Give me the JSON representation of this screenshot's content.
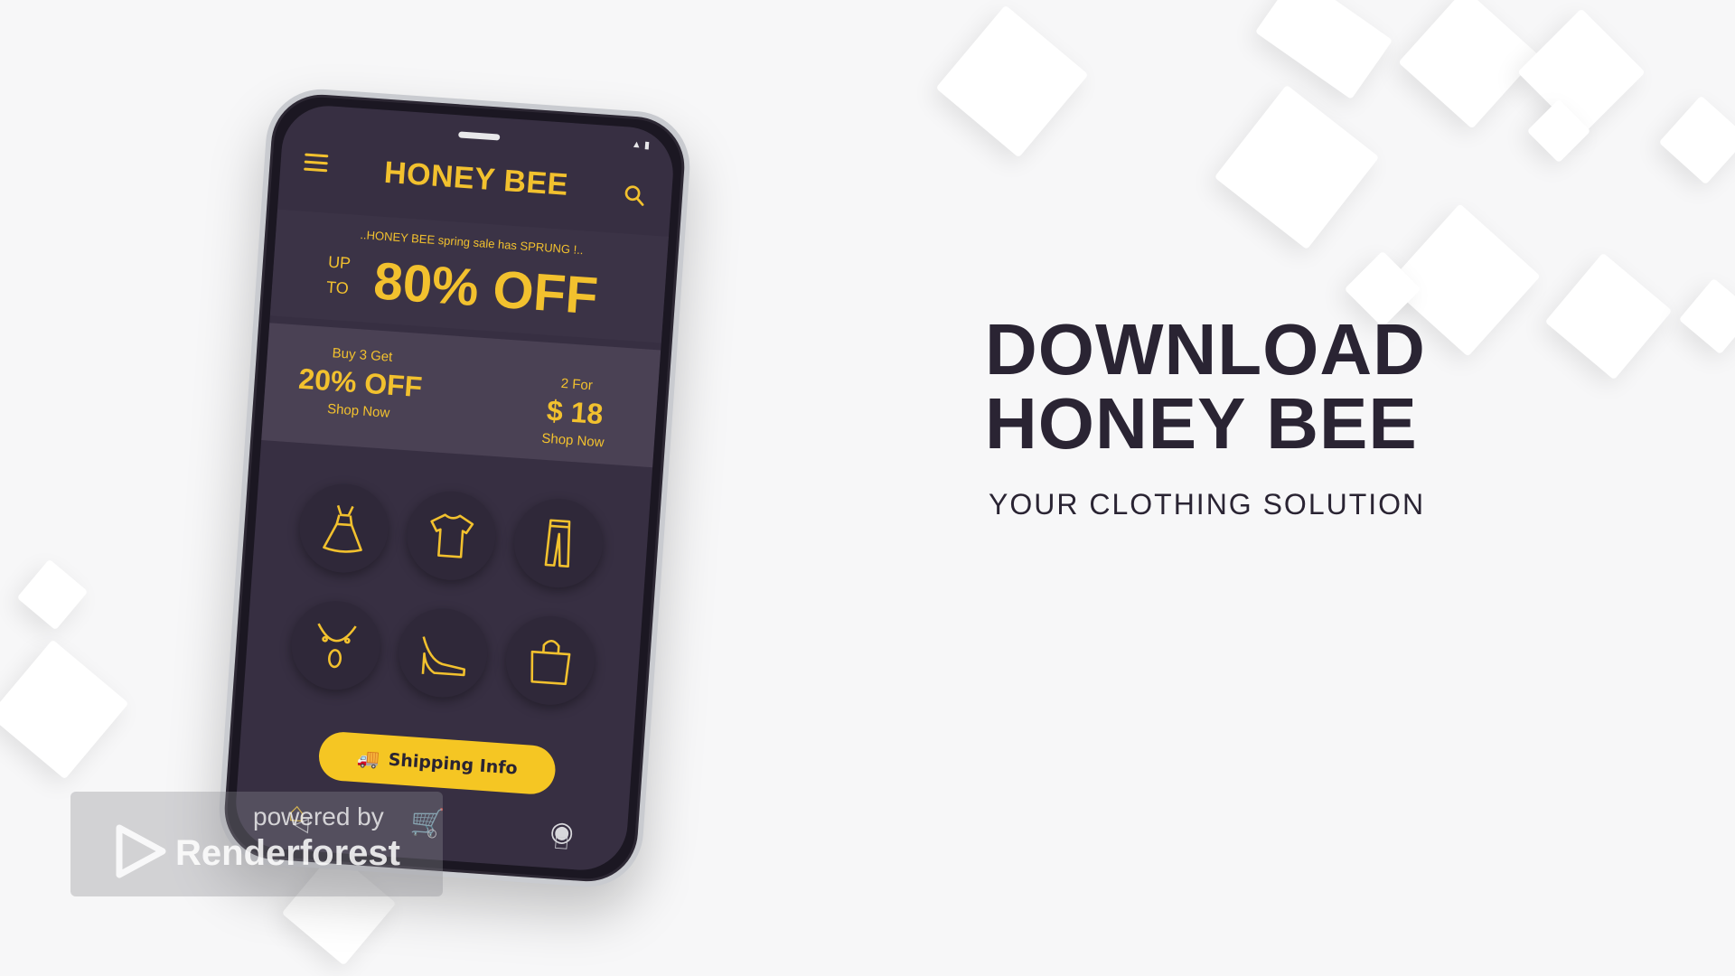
{
  "colors": {
    "accent": "#f2c12e",
    "phone_screen": "#372f42",
    "headline": "#2a2433"
  },
  "app": {
    "title": "HONEY BEE",
    "header_icons": [
      "menu-icon",
      "search-icon"
    ],
    "promo": {
      "tagline": "..HONEY BEE spring sale has SPRUNG !..",
      "up": "UP",
      "to": "TO",
      "headline": "80% OFF"
    },
    "deals": [
      {
        "top": "Buy 3 Get",
        "value": "20% OFF",
        "action": "Shop Now"
      },
      {
        "top": "2 For",
        "value": "$ 18",
        "action": "Shop Now"
      }
    ],
    "categories": [
      "dress-icon",
      "tshirt-icon",
      "pants-icon",
      "necklace-icon",
      "heels-icon",
      "bag-icon"
    ],
    "shipping_button": "Shipping Info",
    "bottom_nav": [
      "home-icon",
      "cart-icon",
      "profile-icon"
    ]
  },
  "headline": {
    "line1": "DOWNLOAD",
    "line2": "HONEY BEE",
    "subtitle": "YOUR CLOTHING SOLUTION"
  },
  "watermark": {
    "powered_by": "powered by",
    "brand": "Renderforest"
  }
}
